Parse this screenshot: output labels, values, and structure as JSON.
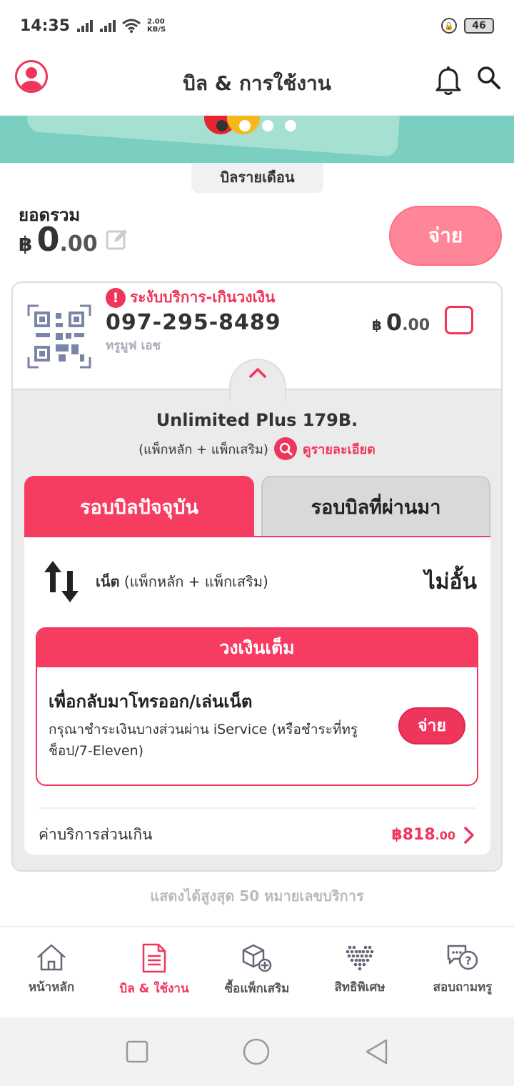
{
  "status_bar": {
    "time": "14:35",
    "net_speed_value": "2.00",
    "net_speed_unit": "KB/S",
    "battery": "46"
  },
  "header": {
    "title": "บิล & การใช้งาน",
    "icons": [
      "profile-icon",
      "bell-icon",
      "search-icon"
    ]
  },
  "banner": {
    "carousel_pages": 4,
    "active_page": 1
  },
  "bill_tab": {
    "label": "บิลรายเดือน"
  },
  "total": {
    "label": "ยอดรวม",
    "currency": "฿",
    "integer": "0",
    "decimal": ".00",
    "pay_label": "จ่าย"
  },
  "account": {
    "warning": "ระงับบริการ-เกินวงเงิน",
    "warning_badge": "!",
    "phone": "097-295-8489",
    "subtitle": "ทรูมูฟ เอช",
    "currency": "฿",
    "integer": "0",
    "decimal": ".00",
    "package_name": "Unlimited Plus 179B.",
    "package_sub": "(แพ็กหลัก +  แพ็กเสริม)",
    "detail_link": "ดูรายละเอียด"
  },
  "tabs": {
    "current": "รอบบิลปัจจุบัน",
    "past": "รอบบิลที่ผ่านมา"
  },
  "usage": {
    "net_label_bold": "เน็ต",
    "net_label_rest": " (แพ็กหลัก + แพ็กเสริม)",
    "net_value": "ไม่อั้น"
  },
  "credit_full": {
    "header": "วงเงินเต็ม",
    "title": "เพื่อกลับมาโทรออก/เล่นเน็ต",
    "text": "กรุณาชำระเงินบางส่วนผ่าน iService (หรือชำระที่ทรูช็อป/7-Eleven)",
    "pay_label": "จ่าย"
  },
  "overage": {
    "label": "ค่าบริการส่วนเกิน",
    "amount_int": "฿818",
    "amount_dec": ".00"
  },
  "max_note": "แสดงได้สูงสุด 50 หมายเลขบริการ",
  "bottom_nav": [
    {
      "label": "หน้าหลัก",
      "icon": "home-icon"
    },
    {
      "label": "บิล & ใช้งาน",
      "icon": "bill-icon",
      "active": true
    },
    {
      "label": "ซื้อแพ็กเสริม",
      "icon": "box-plus-icon"
    },
    {
      "label": "สิทธิพิเศษ",
      "icon": "heart-dots-icon"
    },
    {
      "label": "สอบถามทรู",
      "icon": "chat-question-icon"
    }
  ],
  "colors": {
    "accent": "#f0355c",
    "accent_light": "#ff8598",
    "banner": "#7acfc0"
  }
}
